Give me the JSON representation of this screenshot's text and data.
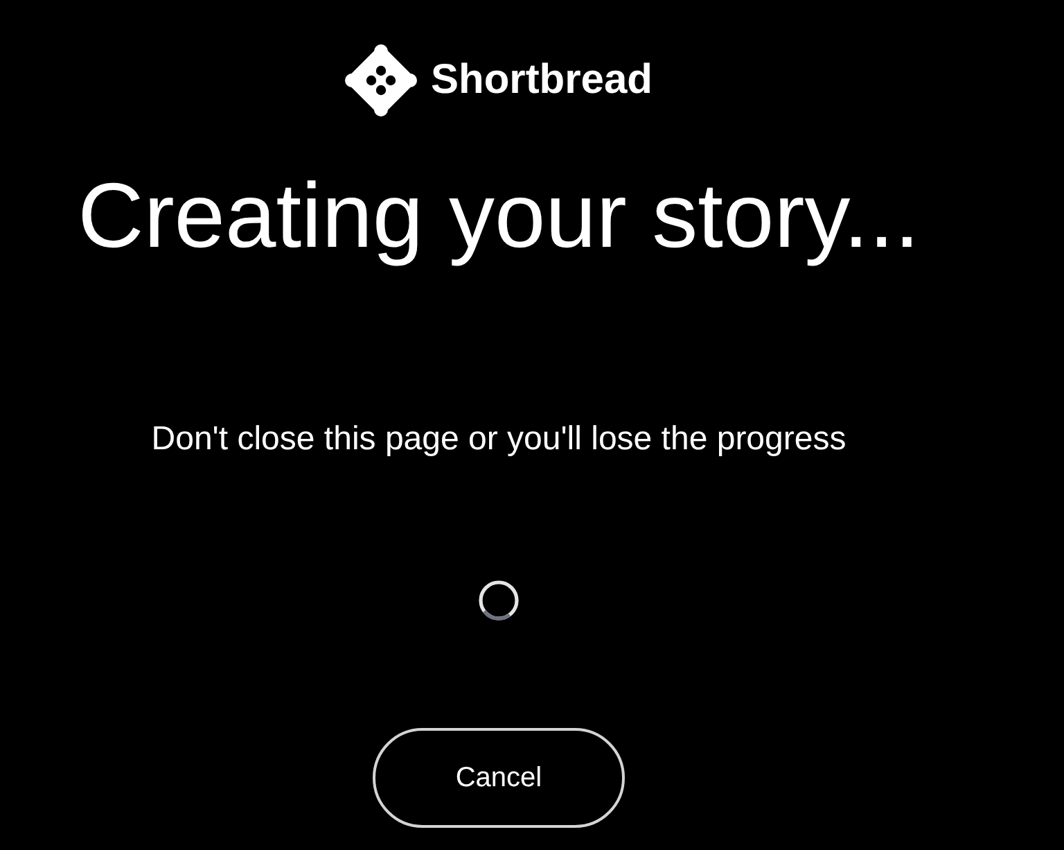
{
  "logo": {
    "name": "Shortbread"
  },
  "heading": "Creating your story...",
  "message": "Don't close this page or you'll lose the progress",
  "cancel_button": {
    "label": "Cancel"
  }
}
